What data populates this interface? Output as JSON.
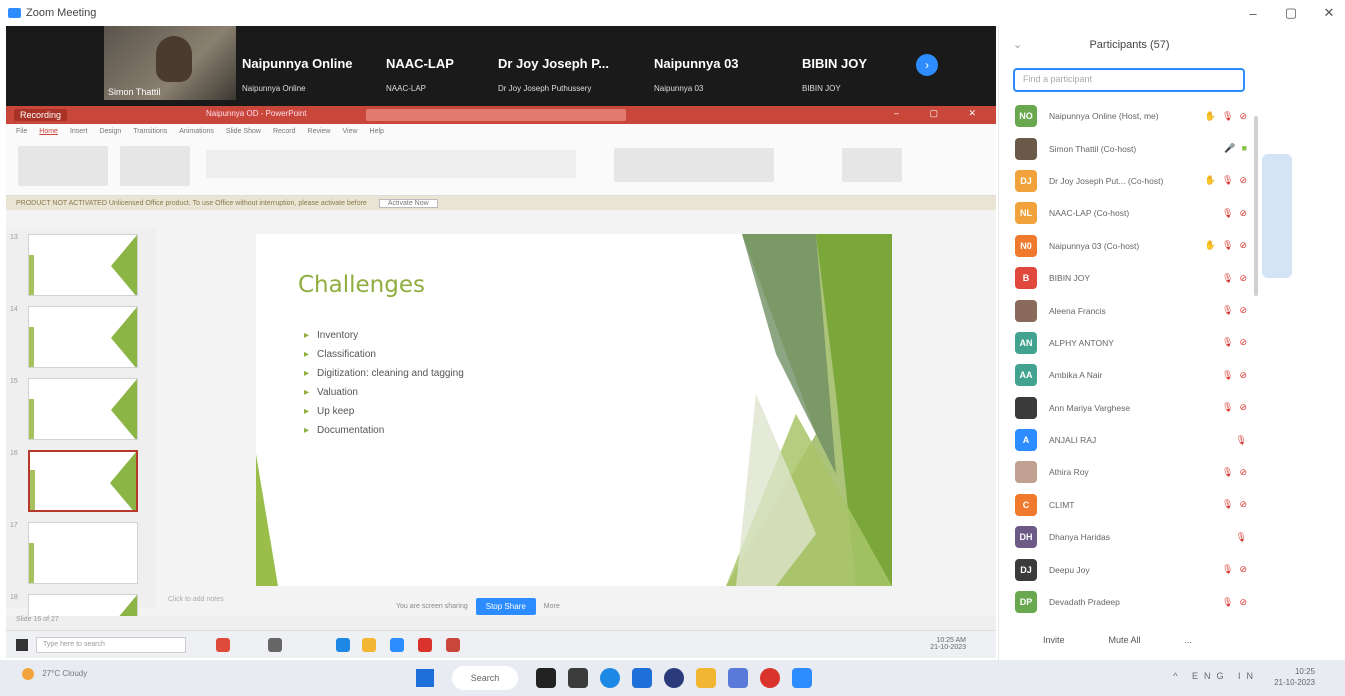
{
  "window": {
    "title": "Zoom Meeting",
    "controls": [
      "–",
      "▢",
      "✕"
    ]
  },
  "gallery": {
    "video_tile": {
      "name": "Simon Thattil"
    },
    "tiles": [
      {
        "name": "Naipunnya Online",
        "label": "Naipunnya Online"
      },
      {
        "name": "NAAC-LAP",
        "label": "NAAC-LAP"
      },
      {
        "name": "Dr Joy Joseph P...",
        "label": "Dr Joy Joseph Puthussery"
      },
      {
        "name": "Naipunnya 03",
        "label": "Naipunnya 03"
      },
      {
        "name": "BIBIN JOY",
        "label": "BIBIN JOY"
      }
    ],
    "next_label": "›"
  },
  "powerpoint": {
    "recording_label": "Recording",
    "doc_title": "Naipunnya OD - PowerPoint",
    "search_placeholder": "Search",
    "tabs": [
      "File",
      "Home",
      "Insert",
      "Design",
      "Transitions",
      "Animations",
      "Slide Show",
      "Record",
      "Review",
      "View",
      "Help"
    ],
    "warning_text": "PRODUCT NOT ACTIVATED   Unlicensed Office product. To use Office without interruption, please activate before",
    "warning_button": "Activate Now",
    "thumb_numbers": [
      "13",
      "14",
      "15",
      "16",
      "17",
      "18"
    ],
    "slide": {
      "title": "Challenges",
      "bullets": [
        "Inventory",
        "Classification",
        "Digitization: cleaning and tagging",
        "Valuation",
        "Up keep",
        "Documentation"
      ]
    },
    "notes_placeholder": "Click to add notes",
    "share_notice": "You are screen sharing",
    "stop_share_label": "Stop Share",
    "more_label": "More",
    "status_text": "Slide 16 of 27",
    "inner_taskbar": {
      "search_placeholder": "Type here to search",
      "clock": "10:25 AM",
      "date": "21-10-2023"
    }
  },
  "participants": {
    "title": "Participants (57)",
    "search_placeholder": "Find a participant",
    "rows": [
      {
        "initials": "NO",
        "name": "Naipunnya Online (Host, me)",
        "color": "#6aa84f",
        "hand": true,
        "audio": "muted",
        "video": "off"
      },
      {
        "initials": "",
        "name": "Simon Thattil (Co-host)",
        "color": "#6b5a4a",
        "hand": false,
        "audio": "on",
        "video": "on"
      },
      {
        "initials": "DJ",
        "name": "Dr Joy Joseph Put... (Co-host)",
        "color": "#f2a23a",
        "hand": true,
        "audio": "muted",
        "video": "off"
      },
      {
        "initials": "NL",
        "name": "NAAC-LAP (Co-host)",
        "color": "#f2a23a",
        "hand": false,
        "audio": "muted",
        "video": "off"
      },
      {
        "initials": "N0",
        "name": "Naipunnya 03 (Co-host)",
        "color": "#ef7a2e",
        "hand": true,
        "audio": "muted",
        "video": "off"
      },
      {
        "initials": "B",
        "name": "BIBIN JOY",
        "color": "#e0483e",
        "hand": false,
        "audio": "muted",
        "video": "off"
      },
      {
        "initials": "",
        "name": "Aleena Francis",
        "color": "#8a6a5a",
        "hand": false,
        "audio": "muted",
        "video": "off"
      },
      {
        "initials": "AN",
        "name": "ALPHY ANTONY",
        "color": "#43a391",
        "hand": false,
        "audio": "muted",
        "video": "off"
      },
      {
        "initials": "AA",
        "name": "Ambika A Nair",
        "color": "#43a391",
        "hand": false,
        "audio": "muted",
        "video": "off"
      },
      {
        "initials": "",
        "name": "Ann Mariya Varghese",
        "color": "#3a3a3a",
        "hand": false,
        "audio": "muted",
        "video": "off"
      },
      {
        "initials": "A",
        "name": "ANJALI RAJ",
        "color": "#2d8cff",
        "hand": false,
        "audio": "muted",
        "video": "none"
      },
      {
        "initials": "",
        "name": "Athira Roy",
        "color": "#c0a090",
        "hand": false,
        "audio": "muted",
        "video": "off"
      },
      {
        "initials": "C",
        "name": "CLIMT",
        "color": "#ef7a2e",
        "hand": false,
        "audio": "muted",
        "video": "off"
      },
      {
        "initials": "DH",
        "name": "Dhanya Haridas",
        "color": "#6d5a86",
        "hand": false,
        "audio": "muted",
        "video": "none"
      },
      {
        "initials": "DJ",
        "name": "Deepu Joy",
        "color": "#3b3b3b",
        "hand": false,
        "audio": "muted",
        "video": "off"
      },
      {
        "initials": "DP",
        "name": "Devadath Pradeep",
        "color": "#6aa84f",
        "hand": false,
        "audio": "muted",
        "video": "off"
      }
    ],
    "invite_label": "Invite",
    "mute_all_label": "Mute All",
    "more_label": "..."
  },
  "taskbar": {
    "weather_temp": "27°C",
    "weather_desc": "Cloudy",
    "search_label": "Search",
    "tray_text": "^  ENG  IN",
    "time": "10:25",
    "date": "21-10-2023"
  },
  "colors": {
    "zoom_blue": "#2d8cff",
    "ppt_red": "#c8473a",
    "slide_green": "#8fae3e"
  }
}
